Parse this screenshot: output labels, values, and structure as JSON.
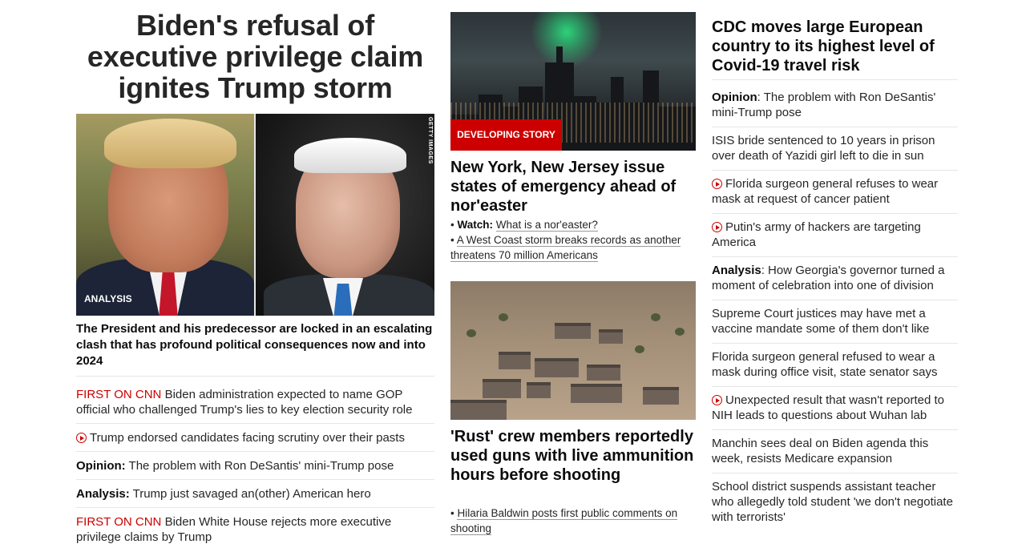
{
  "lead": {
    "headline": "Biden's refusal of executive privilege claim ignites Trump storm",
    "image_credit": "GETTY IMAGES",
    "image_label": "ANALYSIS",
    "summary": "The President and his predecessor are locked in an escalating clash that has profound political consequences now and into 2024",
    "stories": [
      {
        "prefix": "FIRST ON CNN",
        "text": " Biden administration expected to name GOP official who challenged Trump's lies to key election security role"
      },
      {
        "prefix": "",
        "text": "Trump endorsed candidates facing scrutiny over their pasts"
      },
      {
        "prefix": "Opinion:",
        "text": " The problem with Ron DeSantis' mini-Trump pose"
      },
      {
        "prefix": "Analysis:",
        "text": " Trump just savaged an(other) American hero"
      },
      {
        "prefix": "FIRST ON CNN",
        "text": " Biden White House rejects more executive privilege claims by Trump"
      }
    ]
  },
  "middle": {
    "story1": {
      "badge": "DEVELOPING STORY",
      "headline": "New York, New Jersey issue states of emergency ahead of nor'easter",
      "bullet1_prefix": "Watch:",
      "bullet1_text": "What is a nor'easter?",
      "bullet2_text": "A West Coast storm breaks records as another threatens 70 million Americans"
    },
    "story2": {
      "headline": "'Rust' crew members reportedly used guns with live ammunition hours before shooting",
      "bullet1_text": "Hilaria Baldwin posts first public comments on shooting"
    }
  },
  "right": {
    "headline": "CDC moves large European country to its highest level of Covid-19 travel risk",
    "stories": [
      {
        "prefix": "Opinion",
        "text": ": The problem with Ron DeSantis' mini-Trump pose"
      },
      {
        "prefix": "",
        "text": "ISIS bride sentenced to 10 years in prison over death of Yazidi girl left to die in sun"
      },
      {
        "prefix": "",
        "text": "Florida surgeon general refuses to wear mask at request of cancer patient"
      },
      {
        "prefix": "",
        "text": "Putin's army of hackers are targeting America"
      },
      {
        "prefix": "Analysis",
        "text": ": How Georgia's governor turned a moment of celebration into one of division"
      },
      {
        "prefix": "",
        "text": "Supreme Court justices may have met a vaccine mandate some of them don't like"
      },
      {
        "prefix": "",
        "text": "Florida surgeon general refused to wear a mask during office visit, state senator says"
      },
      {
        "prefix": "",
        "text": "Unexpected result that wasn't reported to NIH leads to questions about Wuhan lab"
      },
      {
        "prefix": "",
        "text": "Manchin sees deal on Biden agenda this week, resists Medicare expansion"
      },
      {
        "prefix": "",
        "text": "School district suspends assistant teacher who allegedly told student 'we don't negotiate with terrorists'"
      }
    ]
  },
  "colors": {
    "accent_red": "#cc0000",
    "text": "#262626",
    "divider": "#e6e6e6"
  },
  "icons": {
    "video": "play-circle-icon"
  }
}
